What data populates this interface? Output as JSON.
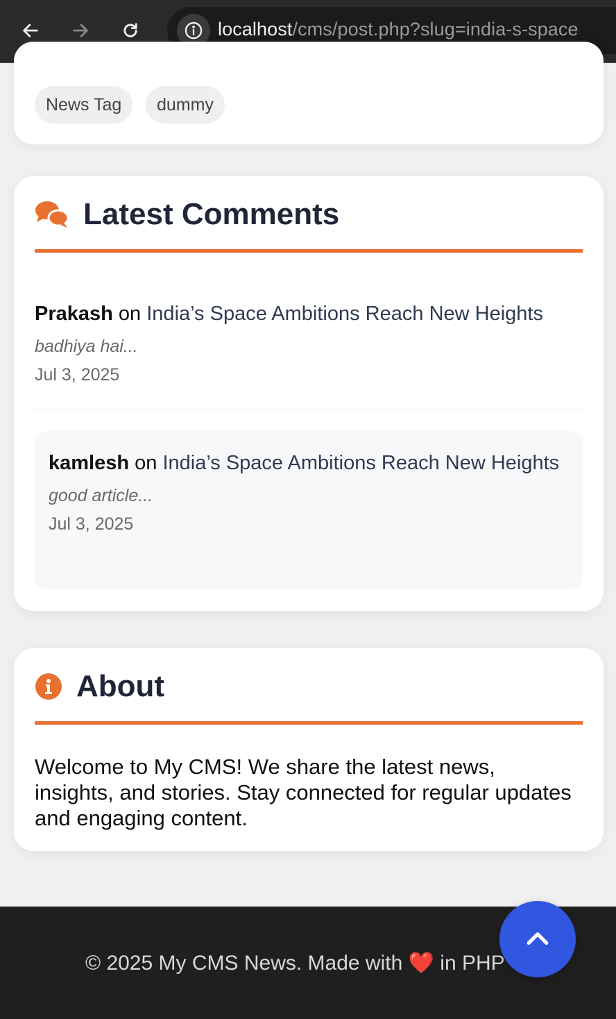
{
  "browser": {
    "url_host": "localhost",
    "url_path": "/cms/post.php?slug=india-s-space"
  },
  "tags": [
    "News Tag",
    "dummy"
  ],
  "comments_section": {
    "title": "Latest Comments",
    "items": [
      {
        "author": "Prakash",
        "on": "on",
        "post_title": "India’s Space Ambitions Reach New Heights",
        "text": "badhiya hai...",
        "date": "Jul 3, 2025"
      },
      {
        "author": "kamlesh",
        "on": "on",
        "post_title": "India’s Space Ambitions Reach New Heights",
        "text": "good article...",
        "date": "Jul 3, 2025"
      }
    ]
  },
  "about_section": {
    "title": "About",
    "text": "Welcome to My CMS! We share the latest news, insights, and stories. Stay connected for regular updates and engaging content."
  },
  "footer": {
    "text_before": "© 2025 My CMS News. Made with ",
    "heart": "❤️",
    "text_after": " in PHP"
  },
  "colors": {
    "accent": "#e8712f",
    "scroll_button": "#3157e0",
    "heading": "#1e2638"
  }
}
